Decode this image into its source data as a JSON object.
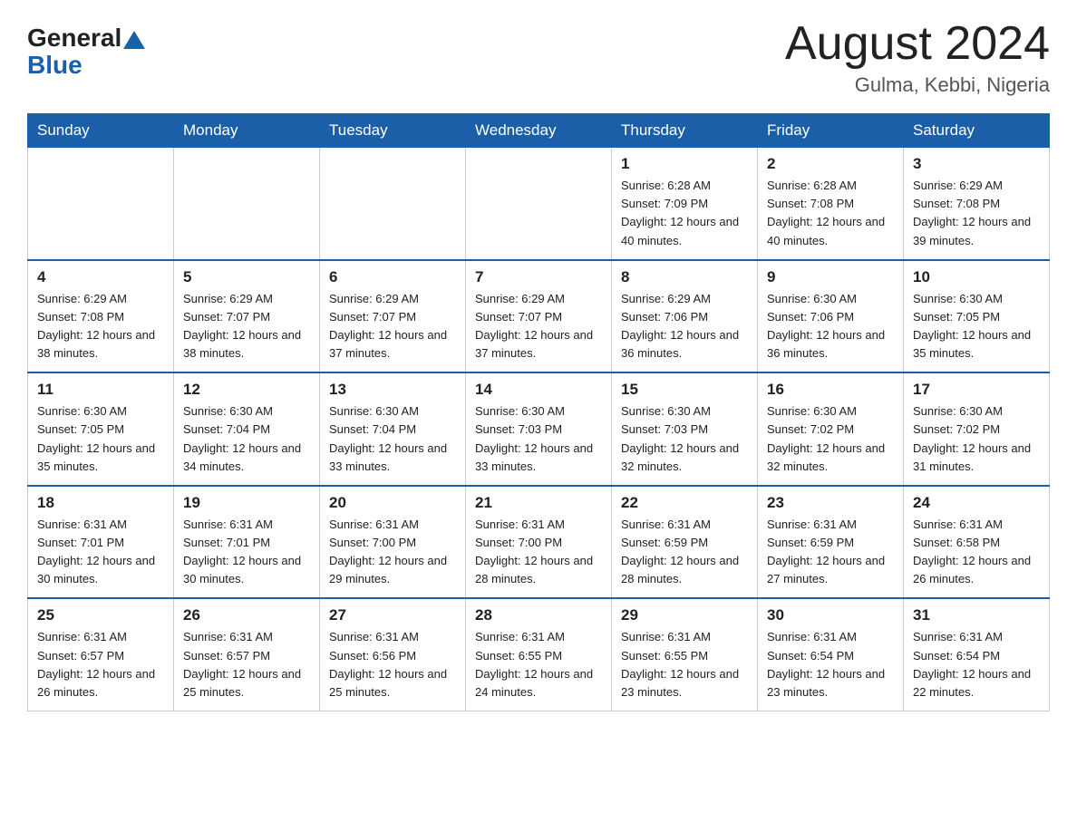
{
  "logo": {
    "general": "General",
    "blue": "Blue"
  },
  "title": {
    "month_year": "August 2024",
    "location": "Gulma, Kebbi, Nigeria"
  },
  "weekdays": [
    "Sunday",
    "Monday",
    "Tuesday",
    "Wednesday",
    "Thursday",
    "Friday",
    "Saturday"
  ],
  "weeks": [
    [
      {
        "day": "",
        "info": ""
      },
      {
        "day": "",
        "info": ""
      },
      {
        "day": "",
        "info": ""
      },
      {
        "day": "",
        "info": ""
      },
      {
        "day": "1",
        "info": "Sunrise: 6:28 AM\nSunset: 7:09 PM\nDaylight: 12 hours and 40 minutes."
      },
      {
        "day": "2",
        "info": "Sunrise: 6:28 AM\nSunset: 7:08 PM\nDaylight: 12 hours and 40 minutes."
      },
      {
        "day": "3",
        "info": "Sunrise: 6:29 AM\nSunset: 7:08 PM\nDaylight: 12 hours and 39 minutes."
      }
    ],
    [
      {
        "day": "4",
        "info": "Sunrise: 6:29 AM\nSunset: 7:08 PM\nDaylight: 12 hours and 38 minutes."
      },
      {
        "day": "5",
        "info": "Sunrise: 6:29 AM\nSunset: 7:07 PM\nDaylight: 12 hours and 38 minutes."
      },
      {
        "day": "6",
        "info": "Sunrise: 6:29 AM\nSunset: 7:07 PM\nDaylight: 12 hours and 37 minutes."
      },
      {
        "day": "7",
        "info": "Sunrise: 6:29 AM\nSunset: 7:07 PM\nDaylight: 12 hours and 37 minutes."
      },
      {
        "day": "8",
        "info": "Sunrise: 6:29 AM\nSunset: 7:06 PM\nDaylight: 12 hours and 36 minutes."
      },
      {
        "day": "9",
        "info": "Sunrise: 6:30 AM\nSunset: 7:06 PM\nDaylight: 12 hours and 36 minutes."
      },
      {
        "day": "10",
        "info": "Sunrise: 6:30 AM\nSunset: 7:05 PM\nDaylight: 12 hours and 35 minutes."
      }
    ],
    [
      {
        "day": "11",
        "info": "Sunrise: 6:30 AM\nSunset: 7:05 PM\nDaylight: 12 hours and 35 minutes."
      },
      {
        "day": "12",
        "info": "Sunrise: 6:30 AM\nSunset: 7:04 PM\nDaylight: 12 hours and 34 minutes."
      },
      {
        "day": "13",
        "info": "Sunrise: 6:30 AM\nSunset: 7:04 PM\nDaylight: 12 hours and 33 minutes."
      },
      {
        "day": "14",
        "info": "Sunrise: 6:30 AM\nSunset: 7:03 PM\nDaylight: 12 hours and 33 minutes."
      },
      {
        "day": "15",
        "info": "Sunrise: 6:30 AM\nSunset: 7:03 PM\nDaylight: 12 hours and 32 minutes."
      },
      {
        "day": "16",
        "info": "Sunrise: 6:30 AM\nSunset: 7:02 PM\nDaylight: 12 hours and 32 minutes."
      },
      {
        "day": "17",
        "info": "Sunrise: 6:30 AM\nSunset: 7:02 PM\nDaylight: 12 hours and 31 minutes."
      }
    ],
    [
      {
        "day": "18",
        "info": "Sunrise: 6:31 AM\nSunset: 7:01 PM\nDaylight: 12 hours and 30 minutes."
      },
      {
        "day": "19",
        "info": "Sunrise: 6:31 AM\nSunset: 7:01 PM\nDaylight: 12 hours and 30 minutes."
      },
      {
        "day": "20",
        "info": "Sunrise: 6:31 AM\nSunset: 7:00 PM\nDaylight: 12 hours and 29 minutes."
      },
      {
        "day": "21",
        "info": "Sunrise: 6:31 AM\nSunset: 7:00 PM\nDaylight: 12 hours and 28 minutes."
      },
      {
        "day": "22",
        "info": "Sunrise: 6:31 AM\nSunset: 6:59 PM\nDaylight: 12 hours and 28 minutes."
      },
      {
        "day": "23",
        "info": "Sunrise: 6:31 AM\nSunset: 6:59 PM\nDaylight: 12 hours and 27 minutes."
      },
      {
        "day": "24",
        "info": "Sunrise: 6:31 AM\nSunset: 6:58 PM\nDaylight: 12 hours and 26 minutes."
      }
    ],
    [
      {
        "day": "25",
        "info": "Sunrise: 6:31 AM\nSunset: 6:57 PM\nDaylight: 12 hours and 26 minutes."
      },
      {
        "day": "26",
        "info": "Sunrise: 6:31 AM\nSunset: 6:57 PM\nDaylight: 12 hours and 25 minutes."
      },
      {
        "day": "27",
        "info": "Sunrise: 6:31 AM\nSunset: 6:56 PM\nDaylight: 12 hours and 25 minutes."
      },
      {
        "day": "28",
        "info": "Sunrise: 6:31 AM\nSunset: 6:55 PM\nDaylight: 12 hours and 24 minutes."
      },
      {
        "day": "29",
        "info": "Sunrise: 6:31 AM\nSunset: 6:55 PM\nDaylight: 12 hours and 23 minutes."
      },
      {
        "day": "30",
        "info": "Sunrise: 6:31 AM\nSunset: 6:54 PM\nDaylight: 12 hours and 23 minutes."
      },
      {
        "day": "31",
        "info": "Sunrise: 6:31 AM\nSunset: 6:54 PM\nDaylight: 12 hours and 22 minutes."
      }
    ]
  ]
}
